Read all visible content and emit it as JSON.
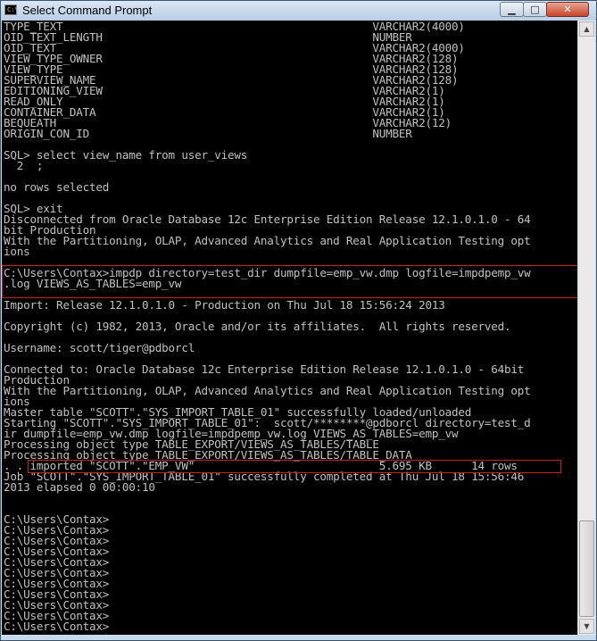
{
  "window": {
    "title": "Select Command Prompt",
    "icon_text": "C:\\",
    "minimize_glyph": "▁",
    "maximize_glyph": "□",
    "close_glyph": "✕"
  },
  "console": {
    "lines": [
      "TYPE_TEXT                                               VARCHAR2(4000)",
      "OID_TEXT_LENGTH                                         NUMBER",
      "OID_TEXT                                                VARCHAR2(4000)",
      "VIEW_TYPE_OWNER                                         VARCHAR2(128)",
      "VIEW_TYPE                                               VARCHAR2(128)",
      "SUPERVIEW_NAME                                          VARCHAR2(128)",
      "EDITIONING_VIEW                                         VARCHAR2(1)",
      "READ_ONLY                                               VARCHAR2(1)",
      "CONTAINER_DATA                                          VARCHAR2(1)",
      "BEQUEATH                                                VARCHAR2(12)",
      "ORIGIN_CON_ID                                           NUMBER",
      "",
      "SQL> select view_name from user_views",
      "  2  ;",
      "",
      "no rows selected",
      "",
      "SQL> exit",
      "Disconnected from Oracle Database 12c Enterprise Edition Release 12.1.0.1.0 - 64",
      "bit Production",
      "With the Partitioning, OLAP, Advanced Analytics and Real Application Testing opt",
      "ions",
      "",
      "C:\\Users\\Contax>impdp directory=test_dir dumpfile=emp_vw.dmp logfile=impdpemp_vw",
      ".log VIEWS_AS_TABLES=emp_vw",
      "",
      "Import: Release 12.1.0.1.0 - Production on Thu Jul 18 15:56:24 2013",
      "",
      "Copyright (c) 1982, 2013, Oracle and/or its affiliates.  All rights reserved.",
      "",
      "Username: scott/tiger@pdborcl",
      "",
      "Connected to: Oracle Database 12c Enterprise Edition Release 12.1.0.1.0 - 64bit",
      "Production",
      "With the Partitioning, OLAP, Advanced Analytics and Real Application Testing opt",
      "ions",
      "Master table \"SCOTT\".\"SYS_IMPORT_TABLE_01\" successfully loaded/unloaded",
      "Starting \"SCOTT\".\"SYS_IMPORT_TABLE_01\":  scott/********@pdborcl directory=test_d",
      "ir dumpfile=emp_vw.dmp logfile=impdpemp_vw.log VIEWS_AS_TABLES=emp_vw",
      "Processing object type TABLE_EXPORT/VIEWS_AS_TABLES/TABLE",
      "Processing object type TABLE_EXPORT/VIEWS_AS_TABLES/TABLE_DATA",
      ". . imported \"SCOTT\".\"EMP_VW\"                            5.695 KB      14 rows",
      "Job \"SCOTT\".\"SYS_IMPORT_TABLE_01\" successfully completed at Thu Jul 18 15:56:46",
      "2013 elapsed 0 00:00:10",
      "",
      "",
      "C:\\Users\\Contax>",
      "C:\\Users\\Contax>",
      "C:\\Users\\Contax>",
      "C:\\Users\\Contax>",
      "C:\\Users\\Contax>",
      "C:\\Users\\Contax>",
      "C:\\Users\\Contax>",
      "C:\\Users\\Contax>",
      "C:\\Users\\Contax>",
      "C:\\Users\\Contax>",
      "C:\\Users\\Contax>"
    ]
  },
  "colors": {
    "console_bg": "#000000",
    "console_text": "#c0c0c0",
    "highlight_box": "#c81e1e"
  }
}
